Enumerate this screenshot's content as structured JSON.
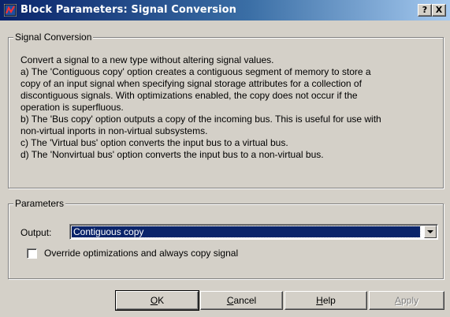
{
  "window": {
    "title": "Block Parameters: Signal Conversion",
    "help_glyph": "?",
    "close_glyph": "X",
    "app_icon": "simulink-block-icon"
  },
  "description_group": {
    "legend": "Signal Conversion",
    "lines": [
      "Convert a signal to a new type without altering signal values.",
      "a) The 'Contiguous copy' option creates a contiguous segment of memory to store a",
      "copy of an input signal when specifying signal storage attributes for a collection of",
      "discontiguous signals.  With optimizations enabled, the copy does not occur if the",
      "operation is superfluous.",
      "b) The 'Bus copy' option outputs a copy of the incoming bus. This is useful for use with",
      "non-virtual inports in non-virtual subsystems.",
      "c) The 'Virtual bus' option converts the input bus to a virtual bus.",
      "d) The 'Nonvirtual bus' option converts the input bus to a non-virtual bus."
    ]
  },
  "parameters_group": {
    "legend": "Parameters",
    "output_label": "Output:",
    "output_value": "Contiguous copy",
    "override_checkbox_label": "Override optimizations and always copy signal",
    "override_checked": false
  },
  "buttons": {
    "ok": {
      "mnemonic": "O",
      "rest": "K"
    },
    "cancel": {
      "mnemonic": "C",
      "rest": "ancel"
    },
    "help": {
      "mnemonic": "H",
      "rest": "elp"
    },
    "apply": {
      "mnemonic": "A",
      "rest": "pply",
      "enabled": false
    }
  },
  "colors": {
    "titlebar_start": "#0a246a",
    "titlebar_end": "#a6caf0",
    "face": "#d4d0c8",
    "selection": "#0a246a"
  }
}
